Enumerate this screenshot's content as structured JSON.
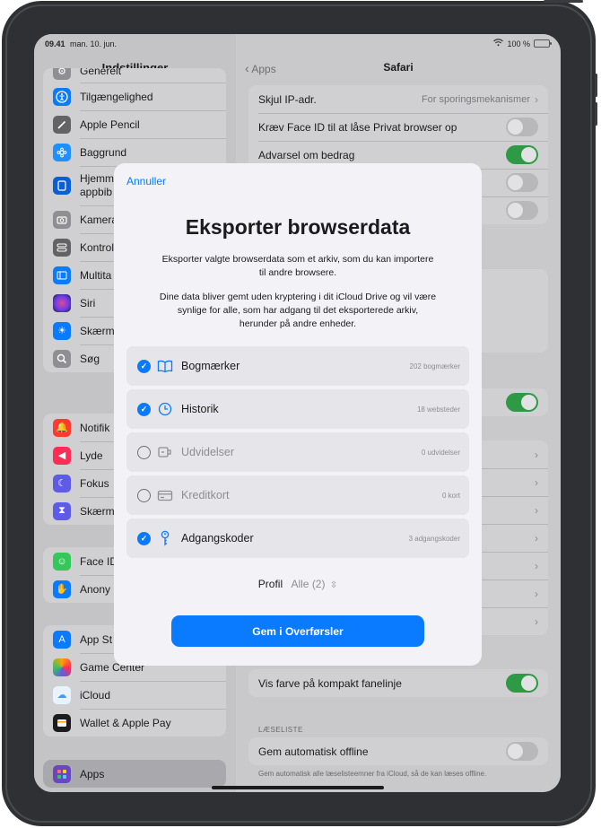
{
  "status": {
    "time": "09.41",
    "date": "man. 10. jun.",
    "battery": "100 %"
  },
  "sidebar": {
    "title": "Indstillinger",
    "groups": [
      {
        "items": [
          {
            "label": "Generelt",
            "icon": "gear-icon",
            "color": "#8e8e93"
          },
          {
            "label": "Tilgængelighed",
            "icon": "accessibility-icon",
            "color": "#0a7aff"
          },
          {
            "label": "Apple Pencil",
            "icon": "pencil-icon",
            "color": "#636366"
          },
          {
            "label": "Baggrund",
            "icon": "wallpaper-icon",
            "color": "#1e90ff"
          },
          {
            "label": "Hjemme appbib",
            "icon": "home-screen-icon",
            "color": "#0a5fd6"
          },
          {
            "label": "Kamera",
            "icon": "camera-icon",
            "color": "#8e8e93"
          },
          {
            "label": "Kontrol",
            "icon": "control-center-icon",
            "color": "#636366"
          },
          {
            "label": "Multita",
            "icon": "multitasking-icon",
            "color": "#0a7aff"
          },
          {
            "label": "Siri",
            "icon": "siri-icon",
            "color": "#2b2b3a"
          },
          {
            "label": "Skærm",
            "icon": "display-icon",
            "color": "#0a7aff"
          },
          {
            "label": "Søg",
            "icon": "search-icon",
            "color": "#8e8e93"
          }
        ]
      },
      {
        "items": [
          {
            "label": "Notifik",
            "icon": "notifications-icon",
            "color": "#ff3b30"
          },
          {
            "label": "Lyde",
            "icon": "sounds-icon",
            "color": "#ff2d55"
          },
          {
            "label": "Fokus",
            "icon": "focus-icon",
            "color": "#5e5ce6"
          },
          {
            "label": "Skærm",
            "icon": "screen-time-icon",
            "color": "#5e5ce6"
          }
        ]
      },
      {
        "items": [
          {
            "label": "Face ID",
            "icon": "face-id-icon",
            "color": "#34c759"
          },
          {
            "label": "Anony",
            "icon": "privacy-icon",
            "color": "#0a7aff"
          }
        ]
      },
      {
        "items": [
          {
            "label": "App St",
            "icon": "app-store-icon",
            "color": "#0a7aff"
          },
          {
            "label": "Game Center",
            "icon": "game-center-icon",
            "color": "#ff9f0a"
          },
          {
            "label": "iCloud",
            "icon": "icloud-icon",
            "color": "#5ac8fa"
          },
          {
            "label": "Wallet & Apple Pay",
            "icon": "wallet-icon",
            "color": "#1c1c1e"
          }
        ]
      }
    ],
    "apps_label": "Apps"
  },
  "detail": {
    "back_label": "Apps",
    "title": "Safari",
    "rows_top": [
      {
        "label": "Skjul IP-adr.",
        "value": "For sporingsmekanismer"
      },
      {
        "label": "Kræv Face ID til at låse Privat browser op"
      },
      {
        "label": "Advarsel om bedrag"
      }
    ],
    "row_bottom": "Vis farve på kompakt fanelinje",
    "section_label": "LÆSELISTE",
    "offline_label": "Gem automatisk offline",
    "footer": "Gem automatisk alle læselisteemner fra iCloud, så de kan læses offline."
  },
  "modal": {
    "cancel": "Annuller",
    "title": "Eksporter browserdata",
    "desc1": "Eksporter valgte browserdata som et arkiv, som du kan importere til andre browsere.",
    "desc2": "Dine data bliver gemt uden kryptering i dit iCloud Drive og vil være synlige for alle, som har adgang til det eksporterede arkiv, herunder på andre enheder.",
    "options": [
      {
        "name": "Bogmærker",
        "count": "202 bogmærker",
        "checked": true,
        "icon": "book-icon"
      },
      {
        "name": "Historik",
        "count": "18 websteder",
        "checked": true,
        "icon": "clock-icon"
      },
      {
        "name": "Udvidelser",
        "count": "0 udvidelser",
        "checked": false,
        "icon": "extension-icon"
      },
      {
        "name": "Kreditkort",
        "count": "0 kort",
        "checked": false,
        "icon": "credit-card-icon"
      },
      {
        "name": "Adgangskoder",
        "count": "3 adgangskoder",
        "checked": true,
        "icon": "key-icon"
      }
    ],
    "profile_label": "Profil",
    "profile_value": "Alle (2)",
    "save_button": "Gem i Overførsler"
  }
}
